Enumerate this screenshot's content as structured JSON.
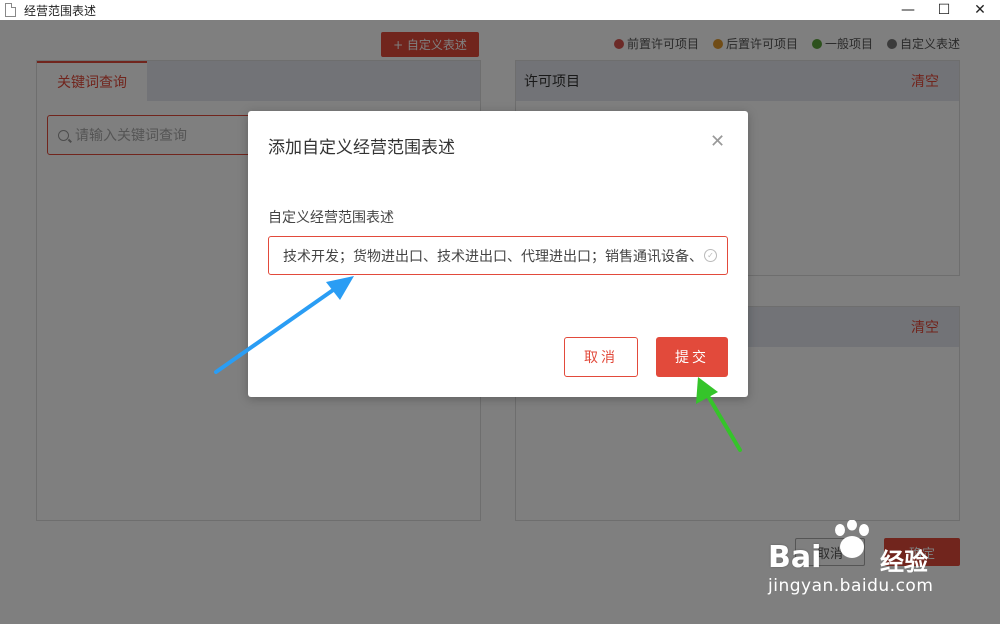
{
  "window": {
    "title": "经营范围表述",
    "minimize": "—",
    "maximize": "☐",
    "close": "✕"
  },
  "toolbar": {
    "add_custom_label": "+ 自定义表述"
  },
  "legend": [
    {
      "label": "前置许可项目",
      "color": "#d9544f"
    },
    {
      "label": "后置许可项目",
      "color": "#e0982c"
    },
    {
      "label": "一般项目",
      "color": "#5ba33b"
    },
    {
      "label": "自定义表述",
      "color": "#777777"
    }
  ],
  "left_panel": {
    "tab_label": "关键词查询",
    "search_placeholder": "请输入关键词查询"
  },
  "right_panels": [
    {
      "title": "许可项目",
      "clear_label": "清空"
    },
    {
      "title": "",
      "clear_label": "清空"
    }
  ],
  "footer": {
    "cancel_label": "取消",
    "confirm_label": "确定"
  },
  "dialog": {
    "title": "添加自定义经营范围表述",
    "field_label": "自定义经营范围表述",
    "field_value": "技术开发；货物进出口、技术进出口、代理进出口；销售通讯设备、",
    "cancel_label": "取消",
    "submit_label": "提交"
  },
  "watermark": {
    "brand": "Bai",
    "brand_suffix": "经验",
    "url": "jingyan.baidu.com"
  }
}
